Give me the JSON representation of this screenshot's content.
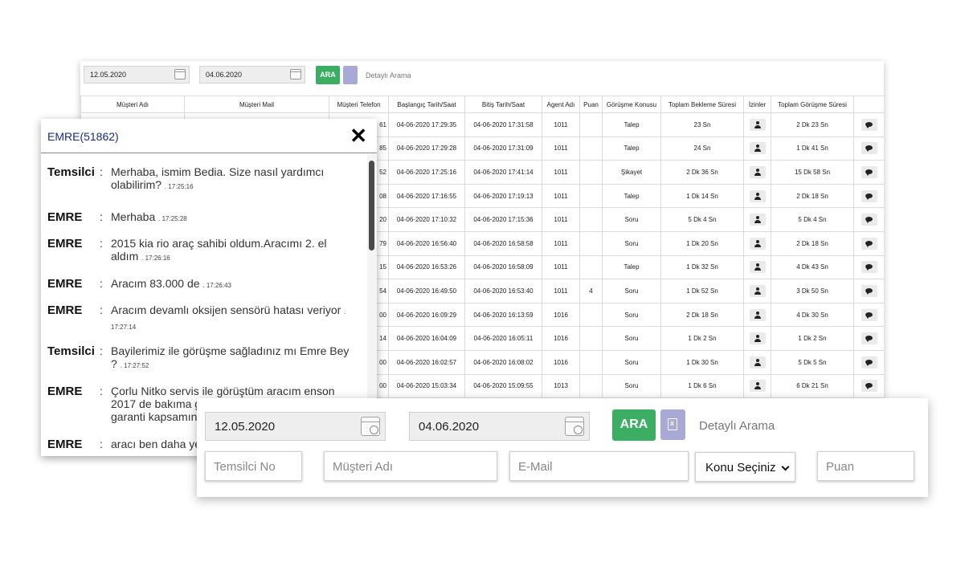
{
  "mini_filter": {
    "start_date": "12.05.2020",
    "end_date": "04.06.2020",
    "search_label": "ARA",
    "detail_label": "Detaylı Arama"
  },
  "table": {
    "columns": [
      "Müşteri Adı",
      "Müşteri Mail",
      "Müşteri Telefon",
      "Başlangıç Tarih/Saat",
      "Bitiş Tarih/Saat",
      "Agent Adı",
      "Puan",
      "Görüşme Konusu",
      "Toplam Bekleme Süresi",
      "İzinler",
      "Toplam Görüşme Süresi",
      ""
    ],
    "rows": [
      {
        "phone": "61",
        "start": "04-06-2020 17:29:35",
        "end": "04-06-2020 17:31:58",
        "agent": "1011",
        "score": "",
        "topic": "Talep",
        "wait": "23 Sn",
        "total": "2 Dk 23 Sn"
      },
      {
        "phone": "85",
        "start": "04-06-2020 17:29:28",
        "end": "04-06-2020 17:31:09",
        "agent": "1011",
        "score": "",
        "topic": "Talep",
        "wait": "24 Sn",
        "total": "1 Dk 41 Sn"
      },
      {
        "phone": "52",
        "start": "04-06-2020 17:25:16",
        "end": "04-06-2020 17:41:14",
        "agent": "1011",
        "score": "",
        "topic": "Şikayet",
        "wait": "2 Dk 36 Sn",
        "total": "15 Dk 58 Sn"
      },
      {
        "phone": "08",
        "start": "04-06-2020 17:16:55",
        "end": "04-06-2020 17:19:13",
        "agent": "1011",
        "score": "",
        "topic": "Talep",
        "wait": "1 Dk 14 Sn",
        "total": "2 Dk 18 Sn"
      },
      {
        "phone": "20",
        "start": "04-06-2020 17:10:32",
        "end": "04-06-2020 17:15:36",
        "agent": "1011",
        "score": "",
        "topic": "Soru",
        "wait": "5 Dk 4 Sn",
        "total": "5 Dk 4 Sn"
      },
      {
        "phone": "79",
        "start": "04-06-2020 16:56:40",
        "end": "04-06-2020 16:58:58",
        "agent": "1011",
        "score": "",
        "topic": "Soru",
        "wait": "1 Dk 20 Sn",
        "total": "2 Dk 18 Sn"
      },
      {
        "phone": "15",
        "start": "04-06-2020 16:53:26",
        "end": "04-06-2020 16:58:09",
        "agent": "1011",
        "score": "",
        "topic": "Talep",
        "wait": "1 Dk 32 Sn",
        "total": "4 Dk 43 Sn"
      },
      {
        "phone": "54",
        "start": "04-06-2020 16:49:50",
        "end": "04-06-2020 16:53:40",
        "agent": "1011",
        "score": "4",
        "topic": "Soru",
        "wait": "1 Dk 52 Sn",
        "total": "3 Dk 50 Sn"
      },
      {
        "phone": "00",
        "start": "04-06-2020 16:09:29",
        "end": "04-06-2020 16:13:59",
        "agent": "1016",
        "score": "",
        "topic": "Soru",
        "wait": "2 Dk 18 Sn",
        "total": "4 Dk 30 Sn"
      },
      {
        "phone": "14",
        "start": "04-06-2020 16:04:09",
        "end": "04-06-2020 16:05:11",
        "agent": "1016",
        "score": "",
        "topic": "Soru",
        "wait": "1 Dk 2 Sn",
        "total": "1 Dk 2 Sn"
      },
      {
        "phone": "00",
        "start": "04-06-2020 16:02:57",
        "end": "04-06-2020 16:08:02",
        "agent": "1016",
        "score": "",
        "topic": "Soru",
        "wait": "1 Dk 30 Sn",
        "total": "5 Dk 5 Sn"
      },
      {
        "phone": "00",
        "start": "04-06-2020 15:03:34",
        "end": "04-06-2020 15:09:55",
        "agent": "1013",
        "score": "",
        "topic": "Soru",
        "wait": "1 Dk 6 Sn",
        "total": "6 Dk 21 Sn"
      }
    ]
  },
  "chat": {
    "title": "EMRE(51862)",
    "close": "✕",
    "messages": [
      {
        "sender": "Temsilci",
        "text": "Merhaba, ismim Bedia. Size nasıl yardımcı olabilirim?",
        "time": "17:25:16"
      },
      {
        "sender": "EMRE",
        "text": "Merhaba",
        "time": "17:25:28"
      },
      {
        "sender": "EMRE",
        "text": "2015 kia rio araç sahibi oldum.Aracımı 2. el aldım",
        "time": "17:26:16"
      },
      {
        "sender": "EMRE",
        "text": "Aracım 83.000 de",
        "time": "17:26:43"
      },
      {
        "sender": "EMRE",
        "text": "Aracım devamlı oksijen sensörü hatası veriyor",
        "time": "17:27:14"
      },
      {
        "sender": "Temsilci",
        "text": "Bayilerimiz ile görüşme sağladınız mı Emre Bey ?",
        "time": "17:27:52"
      },
      {
        "sender": "EMRE",
        "text": "Çorlu Nitko servis ile görüştüm aracım enson 2017 de bakıma g",
        "text2": "garanti kapsamın",
        "time": ""
      },
      {
        "sender": "EMRE",
        "text": "aracı ben daha ye",
        "time": ""
      }
    ]
  },
  "search": {
    "start_date": "12.05.2020",
    "end_date": "04.06.2020",
    "search_label": "ARA",
    "detail_label": "Detaylı Arama",
    "agent_placeholder": "Temsilci No",
    "customer_placeholder": "Müşteri Adı",
    "email_placeholder": "E-Mail",
    "topic_selected": "Konu Seçiniz",
    "score_placeholder": "Puan"
  },
  "colors": {
    "ara_green": "#3cae63",
    "excel_purple": "#a8a9d6",
    "chat_title_blue": "#1a2a8a"
  },
  "icons": {
    "calendar": "calendar-icon",
    "excel": "excel-export-icon",
    "permissions": "user-icon",
    "chat": "chat-bubble-icon",
    "close": "close-icon"
  }
}
